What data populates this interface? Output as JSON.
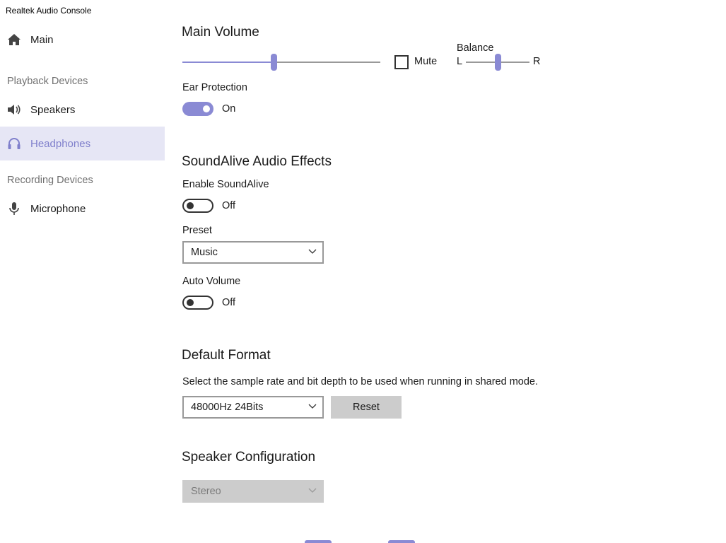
{
  "app": {
    "title": "Realtek Audio Console"
  },
  "sidebar": {
    "main_label": "Main",
    "playback_section": "Playback Devices",
    "recording_section": "Recording Devices",
    "items": [
      {
        "label": "Speakers",
        "icon": "speaker-icon"
      },
      {
        "label": "Headphones",
        "icon": "headphones-icon",
        "selected": true
      },
      {
        "label": "Microphone",
        "icon": "microphone-icon"
      }
    ]
  },
  "main_volume": {
    "heading": "Main Volume",
    "volume_level": 0.46,
    "mute_label": "Mute",
    "muted": false,
    "balance_label": "Balance",
    "balance_left": "L",
    "balance_right": "R",
    "balance_level": 0.5
  },
  "ear_protection": {
    "label": "Ear Protection",
    "state": "On",
    "enabled": true
  },
  "soundalive": {
    "heading": "SoundAlive Audio Effects",
    "enable_label": "Enable SoundAlive",
    "enable_state": "Off",
    "preset_label": "Preset",
    "preset_value": "Music",
    "auto_volume_label": "Auto Volume",
    "auto_volume_state": "Off"
  },
  "default_format": {
    "heading": "Default Format",
    "description": "Select the sample rate and bit depth to be used when running in shared mode.",
    "format_value": "48000Hz 24Bits",
    "reset_label": "Reset"
  },
  "speaker_config": {
    "heading": "Speaker Configuration",
    "value": "Stereo"
  },
  "colors": {
    "accent": "#8a8ad4",
    "selected_bg": "#e6e6f5",
    "selected_text": "#8080cc"
  }
}
